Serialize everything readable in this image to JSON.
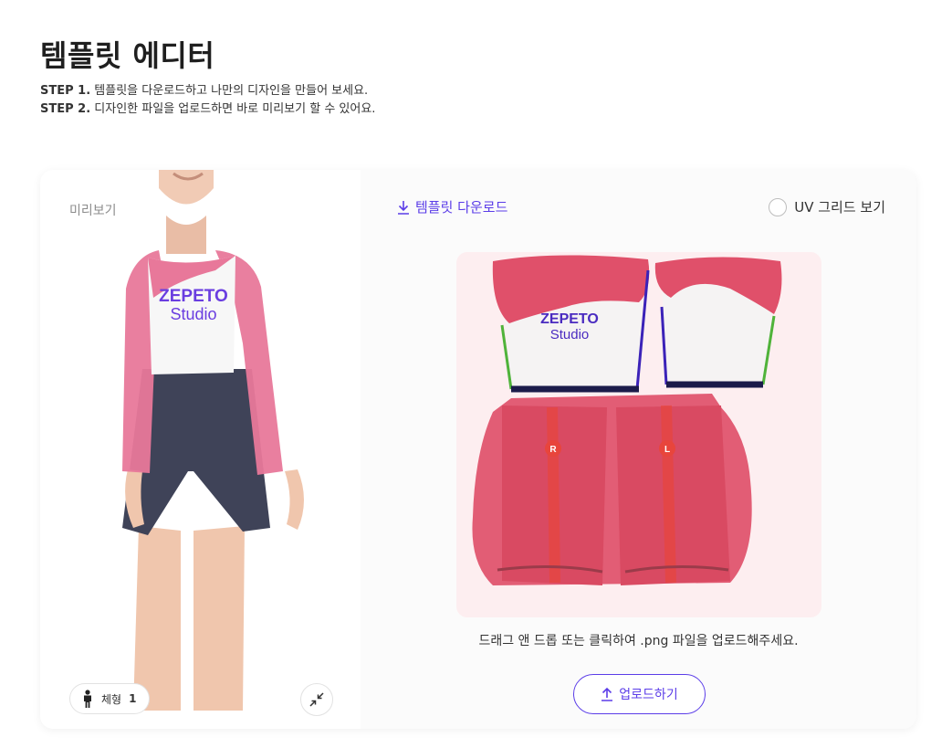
{
  "header": {
    "title": "템플릿 에디터",
    "step1_prefix": "STEP 1.",
    "step1_text": "템플릿을 다운로드하고 나만의 디자인을 만들어 보세요.",
    "step2_prefix": "STEP 2.",
    "step2_text": "디자인한 파일을 업로드하면 바로 미리보기 할 수 있어요."
  },
  "preview": {
    "label": "미리보기",
    "shirt_logo_line1": "ZEPETO",
    "shirt_logo_line2": "Studio",
    "body_type_label": "체형",
    "body_type_value": "1"
  },
  "editor": {
    "download_label": "템플릿 다운로드",
    "uv_grid_label": "UV 그리드 보기",
    "template_logo_line1": "ZEPETO",
    "template_logo_line2": "Studio",
    "marker_right": "R",
    "marker_left": "L",
    "upload_hint": "드래그 앤 드롭 또는 클릭하여 .png 파일을 업로드해주세요.",
    "upload_button": "업로드하기"
  },
  "colors": {
    "accent": "#5b3de8",
    "pink_sleeve": "#e8789a",
    "template_red": "#e0506a",
    "shorts": "#3f4358"
  }
}
